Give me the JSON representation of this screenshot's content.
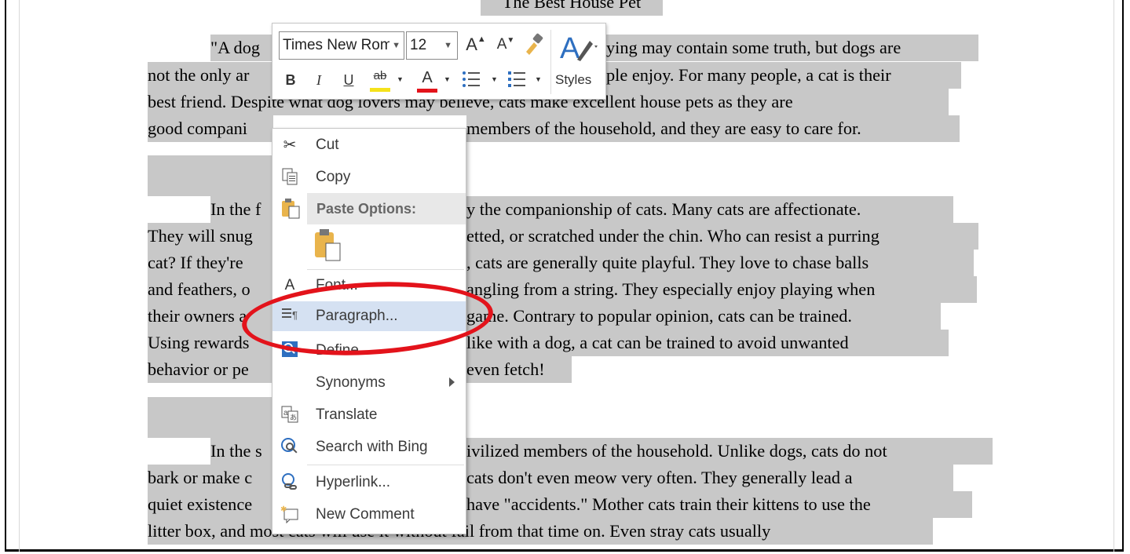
{
  "document": {
    "title": "The Best House Pet",
    "lines": [
      "\"A dog",
      "ying may contain some truth, but dogs are",
      "not the only ar",
      "ple enjoy. For many people, a cat is their",
      "best friend. Despite what dog lovers may believe, cats make excellent house pets as they are",
      "good compani",
      "members of the household, and they are easy to care for.",
      "In the f",
      "y the companionship of cats. Many cats are affectionate.",
      "They will snug",
      "etted, or scratched under the chin. Who can resist a purring",
      "cat? If they're",
      ", cats are generally quite playful. They love to chase balls",
      "and feathers, o",
      "angling from a string. They especially enjoy playing when",
      "their owners a",
      "game. Contrary to popular opinion, cats can be trained.",
      "Using rewards",
      "like with a dog, a cat can be trained to avoid unwanted",
      "behavior or pe",
      "even fetch!",
      "In the s",
      "ivilized members of the household. Unlike dogs, cats do not",
      "bark or make c",
      "cats don't even meow very often. They generally lead a",
      "quiet existence",
      "have \"accidents.\" Mother cats train their kittens to use the",
      "litter box, and most cats will use it without fail from that time on. Even stray cats usually"
    ]
  },
  "mini_toolbar": {
    "font_name": "Times New Roman",
    "font_size": "12",
    "grow_font": "A",
    "shrink_font": "A",
    "bold": "B",
    "italic": "I",
    "underline": "U",
    "highlight": "ab",
    "font_color": "A",
    "styles_label": "Styles",
    "highlight_color": "#f5e21b",
    "font_color_value": "#e3131b"
  },
  "context_menu": {
    "cut": "Cut",
    "copy": "Copy",
    "paste_options": "Paste Options:",
    "font": "Font...",
    "paragraph": "Paragraph...",
    "define": "Define",
    "synonyms": "Synonyms",
    "translate": "Translate",
    "search_bing": "Search with Bing",
    "hyperlink": "Hyperlink...",
    "new_comment": "New Comment"
  },
  "annotation": {
    "ring_color": "#e3131b"
  }
}
